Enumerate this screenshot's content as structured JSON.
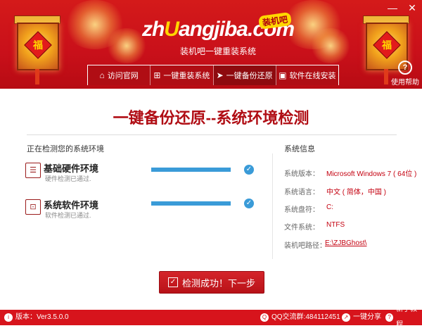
{
  "header": {
    "logo": "zhuangjiba.com",
    "badge": "装机吧",
    "subtitle": "装机吧一键重装系统",
    "lantern_char": "福",
    "window_controls": [
      "—",
      "✕"
    ],
    "help_label": "使用帮助",
    "help_icon": "?"
  },
  "nav": [
    {
      "label": "访问官网",
      "icon": "⌂",
      "icon_name": "home-icon"
    },
    {
      "label": "一键重装系统",
      "icon": "⊞",
      "icon_name": "windows-icon"
    },
    {
      "label": "一键备份还原",
      "icon": "➤",
      "icon_name": "bird-icon"
    },
    {
      "label": "软件在线安装",
      "icon": "▣",
      "icon_name": "apps-icon"
    }
  ],
  "main": {
    "title": "一键备份还原--系统环境检测",
    "left_heading": "正在检测您的系统环境",
    "right_heading": "系统信息",
    "checks": [
      {
        "title": "基础硬件环境",
        "sub": "硬件检测已通过.",
        "icon": "☰"
      },
      {
        "title": "系统软件环境",
        "sub": "软件检测已通过.",
        "icon": "⊡"
      }
    ],
    "check_ok": "✓",
    "info": [
      {
        "key": "系统版本：",
        "value": "Microsoft Windows 7 ( 64位 )"
      },
      {
        "key": "系统语言：",
        "value": "中文 ( 简体，中国 )"
      },
      {
        "key": "系统盘符：",
        "value": "C:"
      },
      {
        "key": "文件系统：",
        "value": "NTFS"
      },
      {
        "key": "装机吧路径：",
        "value": "E:\\ZJBGhost\\"
      }
    ],
    "next_button": "检测成功！下一步",
    "next_check": "✓"
  },
  "footer": {
    "version": "版本：Ver3.5.0.0",
    "qq": "QQ交流群:484112451",
    "share": "一键分享",
    "tutorial": "新手教程"
  },
  "colors": {
    "brand_red": "#c9101a",
    "accent_blue": "#3a9bd8"
  }
}
